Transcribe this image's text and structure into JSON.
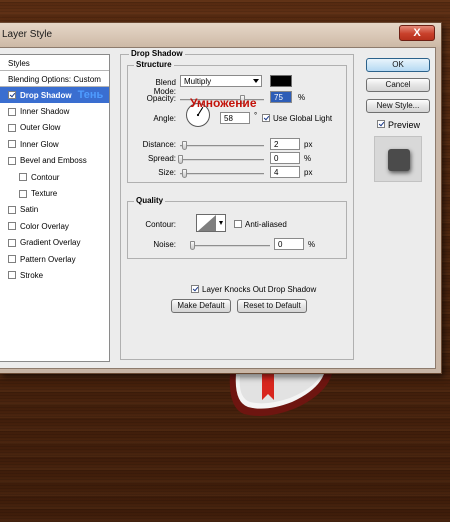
{
  "window": {
    "title": "Layer Style",
    "close_symbol": "X"
  },
  "styles_panel": {
    "header": "Styles",
    "blending_options": "Blending Options: Custom",
    "items": [
      {
        "label": "Drop Shadow",
        "checked": true,
        "active": true,
        "sub": false
      },
      {
        "label": "Inner Shadow",
        "checked": false,
        "active": false,
        "sub": false
      },
      {
        "label": "Outer Glow",
        "checked": false,
        "active": false,
        "sub": false
      },
      {
        "label": "Inner Glow",
        "checked": false,
        "active": false,
        "sub": false
      },
      {
        "label": "Bevel and Emboss",
        "checked": false,
        "active": false,
        "sub": false
      },
      {
        "label": "Contour",
        "checked": false,
        "active": false,
        "sub": true
      },
      {
        "label": "Texture",
        "checked": false,
        "active": false,
        "sub": true
      },
      {
        "label": "Satin",
        "checked": false,
        "active": false,
        "sub": false
      },
      {
        "label": "Color Overlay",
        "checked": false,
        "active": false,
        "sub": false
      },
      {
        "label": "Gradient Overlay",
        "checked": false,
        "active": false,
        "sub": false
      },
      {
        "label": "Pattern Overlay",
        "checked": false,
        "active": false,
        "sub": false
      },
      {
        "label": "Stroke",
        "checked": false,
        "active": false,
        "sub": false
      }
    ]
  },
  "annotations": {
    "shadow_ru": "Тень",
    "multiply_ru": "Умножение"
  },
  "drop_shadow": {
    "title": "Drop Shadow",
    "structure": {
      "title": "Structure",
      "blend_mode_label": "Blend Mode:",
      "blend_mode_value": "Multiply",
      "color": "#000000",
      "opacity_label": "Opacity:",
      "opacity_value": "75",
      "opacity_level": 0.75,
      "percent": "%",
      "angle_label": "Angle:",
      "angle_value": "58",
      "degree": "°",
      "use_global_light_label": "Use Global Light",
      "use_global_light": true,
      "distance_label": "Distance:",
      "distance_value": "2",
      "spread_label": "Spread:",
      "spread_value": "0",
      "size_label": "Size:",
      "size_value": "4",
      "px": "px"
    },
    "quality": {
      "title": "Quality",
      "contour_label": "Contour:",
      "anti_aliased_label": "Anti-aliased",
      "anti_aliased": false,
      "noise_label": "Noise:",
      "noise_value": "0",
      "percent": "%"
    },
    "knocks_out_label": "Layer Knocks Out Drop Shadow",
    "knocks_out": true,
    "make_default_label": "Make Default",
    "reset_default_label": "Reset to Default"
  },
  "buttons": {
    "ok": "OK",
    "cancel": "Cancel",
    "new_style": "New Style...",
    "preview_label": "Preview",
    "preview_checked": true
  },
  "colors": {
    "selection": "#3a6ed0",
    "annotation_blue": "#4e9cff",
    "annotation_red": "#c3130b"
  }
}
